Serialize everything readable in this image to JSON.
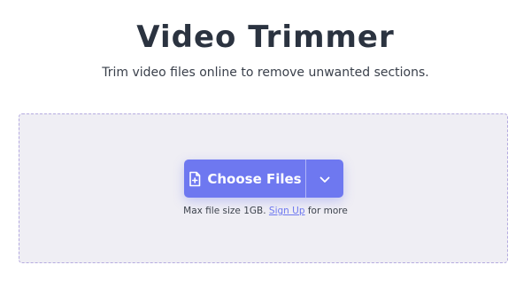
{
  "header": {
    "title": "Video Trimmer",
    "subtitle": "Trim video files online to remove unwanted sections."
  },
  "upload": {
    "choose_label": "Choose Files",
    "limit_prefix": "Max file size 1GB.",
    "signup_link": "Sign Up",
    "limit_suffix": "for more"
  },
  "icons": {
    "choose": "add-file-icon",
    "dropdown": "chevron-down-icon"
  },
  "colors": {
    "accent": "#6e78f0",
    "title": "#2b3340",
    "dropzone_bg": "#efeef4",
    "dropzone_border": "#b5abe0"
  }
}
